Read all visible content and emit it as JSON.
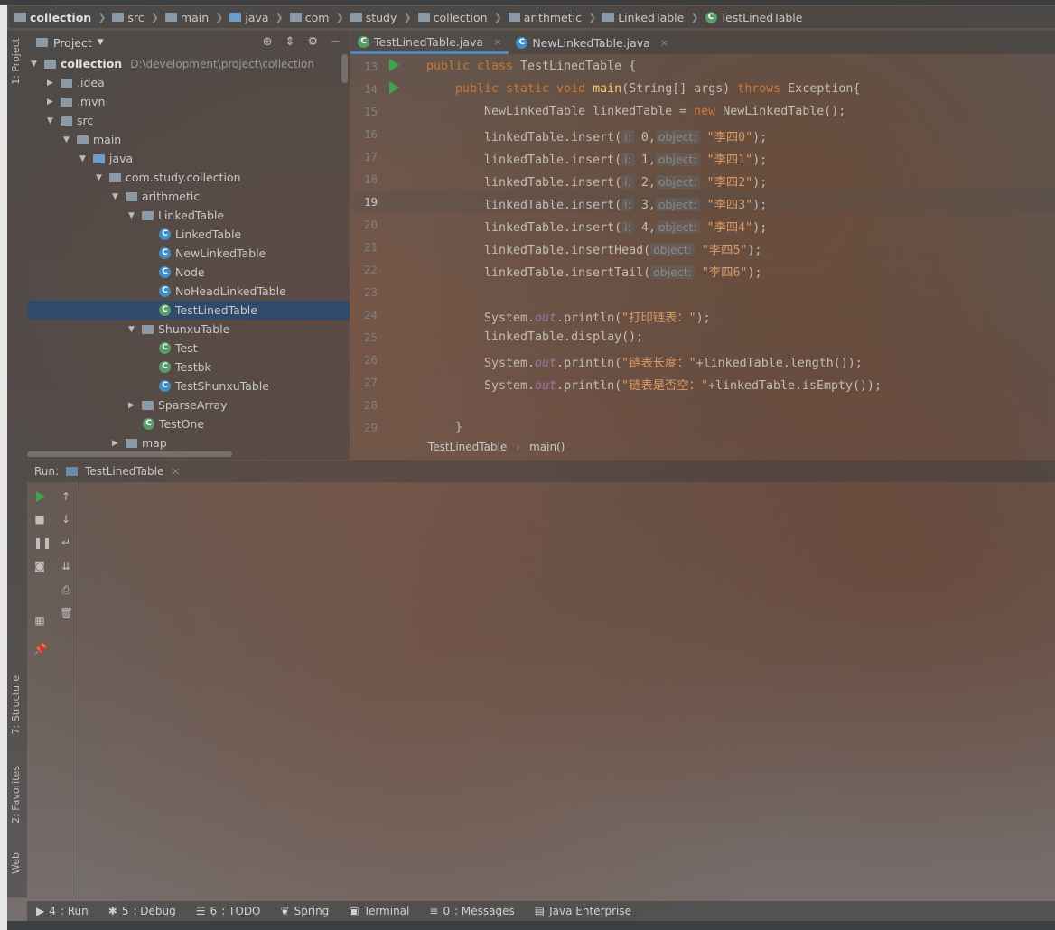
{
  "breadcrumb": [
    "collection",
    "src",
    "main",
    "java",
    "com",
    "study",
    "collection",
    "arithmetic",
    "LinkedTable",
    "TestLinedTable"
  ],
  "side_tabs": {
    "project": "1: Project",
    "structure": "7: Structure",
    "favorites": "2: Favorites",
    "web": "Web"
  },
  "project_panel": {
    "title": "Project",
    "root_name": "collection",
    "root_path": "D:\\development\\project\\collection",
    "tree": [
      {
        "label": ".idea"
      },
      {
        "label": ".mvn"
      },
      {
        "label": "src"
      },
      {
        "label": "main"
      },
      {
        "label": "java"
      },
      {
        "label": "com.study.collection"
      },
      {
        "label": "arithmetic"
      },
      {
        "label": "LinkedTable"
      },
      {
        "label": "LinkedTable"
      },
      {
        "label": "NewLinkedTable"
      },
      {
        "label": "Node"
      },
      {
        "label": "NoHeadLinkedTable"
      },
      {
        "label": "TestLinedTable"
      },
      {
        "label": "ShunxuTable"
      },
      {
        "label": "Test"
      },
      {
        "label": "Testbk"
      },
      {
        "label": "TestShunxuTable"
      },
      {
        "label": "SparseArray"
      },
      {
        "label": "TestOne"
      },
      {
        "label": "map"
      }
    ]
  },
  "editor_tabs": [
    {
      "label": "TestLinedTable.java"
    },
    {
      "label": "NewLinkedTable.java"
    }
  ],
  "line_numbers": [
    "13",
    "14",
    "15",
    "16",
    "17",
    "18",
    "19",
    "20",
    "21",
    "22",
    "23",
    "24",
    "25",
    "26",
    "27",
    "28",
    "29"
  ],
  "code": {
    "l13_kw": "public class",
    "l13_rest": " TestLinedTable {",
    "l14_kw": "public static void",
    "l14_fn": "main",
    "l14_mid": "(String[] args) ",
    "l14_throws": "throws",
    "l14_rest": " Exception{",
    "l15_a": "NewLinkedTable linkedTable = ",
    "l15_new": "new",
    "l15_b": " NewLinkedTable();",
    "insert_prefix": "linkedTable.insert(",
    "hint_i": "i:",
    "hint_object": "object:",
    "inserts": [
      {
        "i": "0,",
        "s": "\"李四0\"",
        "end": ");"
      },
      {
        "i": "1,",
        "s": "\"李四1\"",
        "end": ");"
      },
      {
        "i": "2,",
        "s": "\"李四2\"",
        "end": ");"
      },
      {
        "i": "3,",
        "s": "\"李四3\"",
        "end": ");"
      },
      {
        "i": "4,",
        "s": "\"李四4\"",
        "end": ");"
      }
    ],
    "l21_a": "linkedTable.insertHead(",
    "l21_s": "\"李四5\"",
    "l21_end": ");",
    "l22_a": "linkedTable.insertTail(",
    "l22_s": "\"李四6\"",
    "l22_end": ");",
    "sys": "System.",
    "out": "out",
    "println": ".println(",
    "l24_s": "\"打印链表：\"",
    "l24_end": ");",
    "l25": "linkedTable.display();",
    "l26_s": "\"链表长度：\"",
    "l26_end": "+linkedTable.length());",
    "l27_s": "\"链表是否空：\"",
    "l27_end": "+linkedTable.isEmpty());",
    "l29": "}"
  },
  "editor_breadcrumb": {
    "cls": "TestLinedTable",
    "method": "main()"
  },
  "run_panel": {
    "label": "Run:",
    "tab": "TestLinedTable"
  },
  "bottom_tabs": [
    {
      "key": "4",
      "label": ": Run"
    },
    {
      "key": "5",
      "label": ": Debug"
    },
    {
      "key": "6",
      "label": ": TODO"
    },
    {
      "key": "",
      "label": "Spring"
    },
    {
      "key": "",
      "label": "Terminal"
    },
    {
      "key": "0",
      "label": ": Messages"
    },
    {
      "key": "",
      "label": "Java Enterprise"
    }
  ]
}
